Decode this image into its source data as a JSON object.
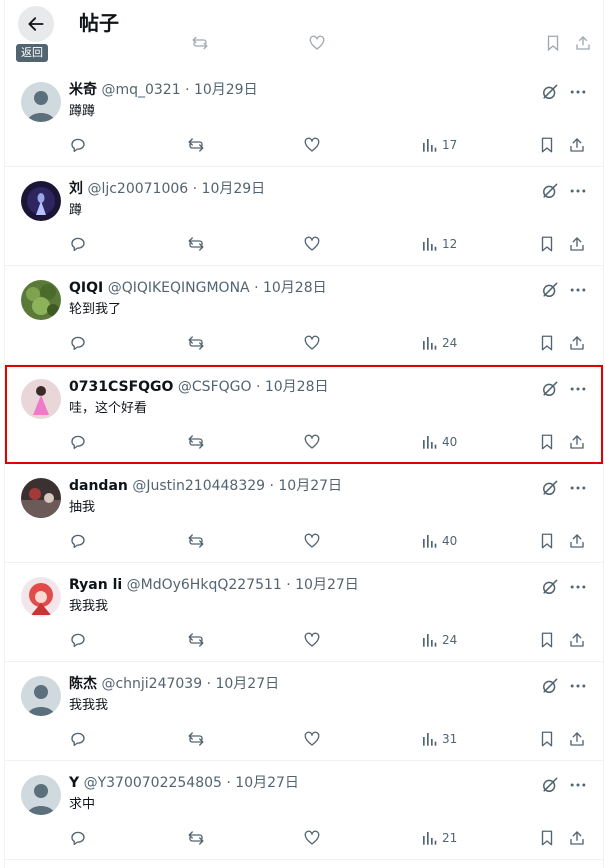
{
  "header": {
    "title": "帖子",
    "back_tooltip": "返回"
  },
  "colors": {
    "highlight_border": "#e00000",
    "secondary_text": "#536471",
    "primary_text": "#0f1419",
    "separator": "#eff3f4"
  },
  "posts": [
    {
      "name": "米奇",
      "handle": "@mq_0321",
      "date": "· 10月29日",
      "text": "蹲蹲",
      "views": "17",
      "avatar": "default-avatar",
      "highlighted": false
    },
    {
      "name": "刘",
      "handle": "@ljc20071006",
      "date": "· 10月29日",
      "text": "蹲",
      "views": "12",
      "avatar": "dark-figure-avatar",
      "highlighted": false
    },
    {
      "name": "QIQI",
      "handle": "@QIQIKEQINGMONA",
      "date": "· 10月28日",
      "text": "轮到我了",
      "views": "24",
      "avatar": "green-plant-avatar",
      "highlighted": false
    },
    {
      "name": "0731CSFQGO",
      "handle": "@CSFQGO",
      "date": "· 10月28日",
      "text": "哇，这个好看",
      "views": "40",
      "avatar": "pink-dress-avatar",
      "highlighted": true
    },
    {
      "name": "dandan",
      "handle": "@Justin210448329",
      "date": "· 10月27日",
      "text": "抽我",
      "views": "40",
      "avatar": "dark-scene-avatar",
      "highlighted": false
    },
    {
      "name": "Ryan li",
      "handle": "@MdOy6HkqQ227511",
      "date": "· 10月27日",
      "text": "我我我",
      "views": "24",
      "avatar": "red-hair-character-avatar",
      "highlighted": false
    },
    {
      "name": "陈杰",
      "handle": "@chnji247039",
      "date": "· 10月27日",
      "text": "我我我",
      "views": "31",
      "avatar": "default-avatar",
      "highlighted": false
    },
    {
      "name": "Y",
      "handle": "@Y3700702254805",
      "date": "· 10月27日",
      "text": "求中",
      "views": "21",
      "avatar": "default-avatar",
      "highlighted": false
    }
  ],
  "icons": {
    "reply": "reply-icon",
    "repost": "repost-icon",
    "like": "like-icon",
    "views": "views-icon",
    "bookmark": "bookmark-icon",
    "share": "share-icon",
    "grok": "grok-icon",
    "more": "more-icon"
  }
}
